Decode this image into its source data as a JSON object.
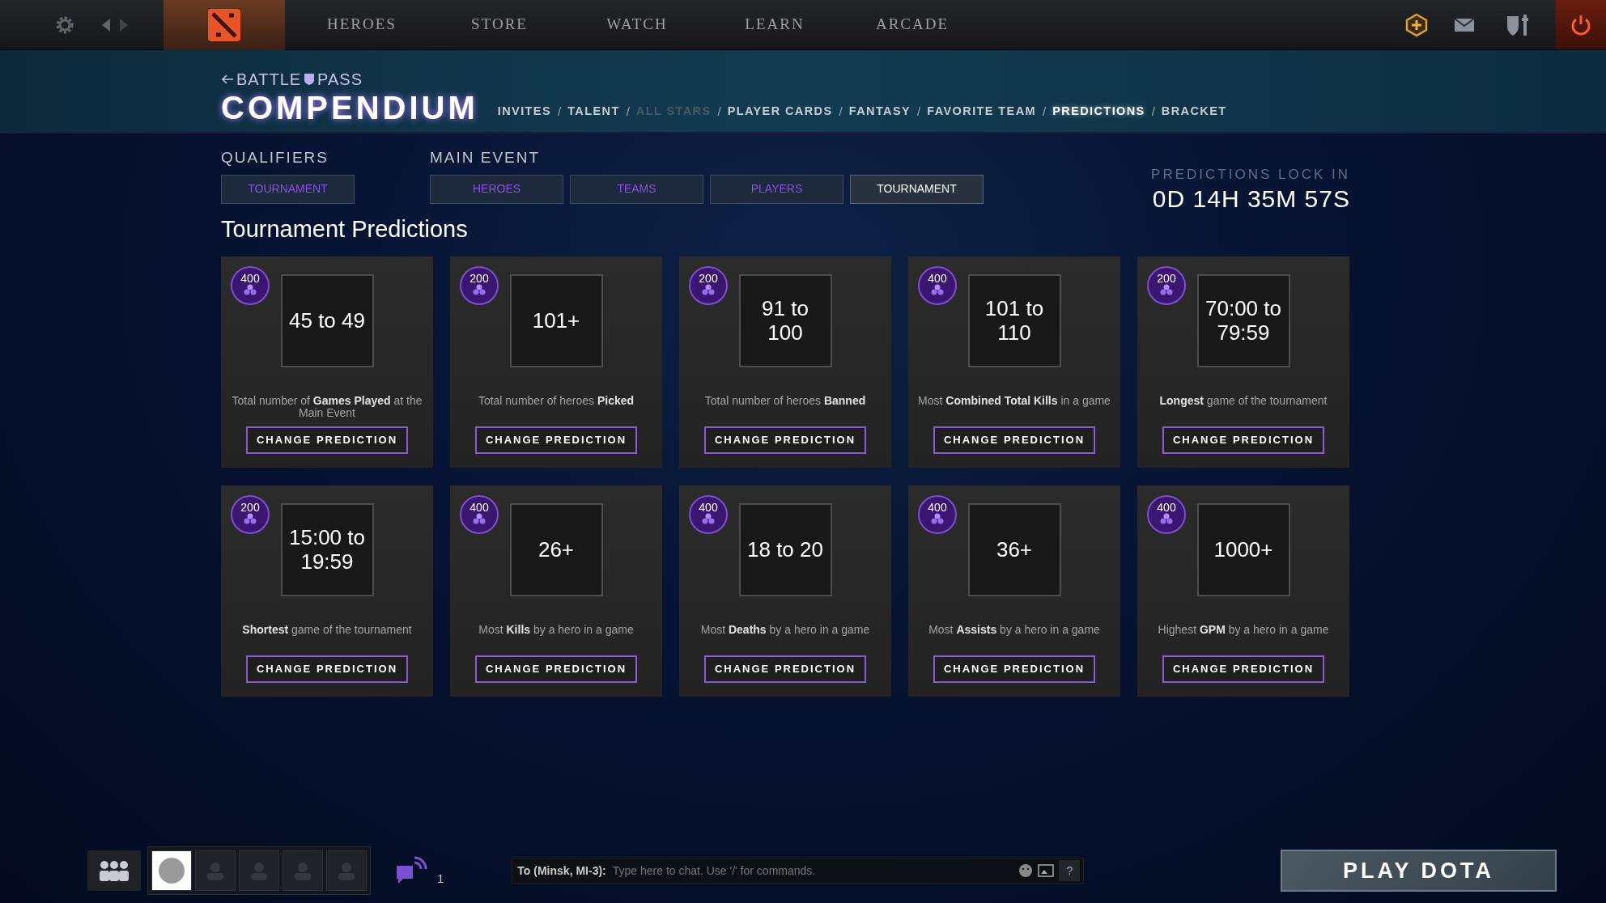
{
  "top_nav": {
    "items": [
      {
        "label": "HEROES"
      },
      {
        "label": "STORE"
      },
      {
        "label": "WATCH"
      },
      {
        "label": "LEARN"
      },
      {
        "label": "ARCADE"
      }
    ]
  },
  "compendium": {
    "back_label": "BATTLE",
    "pass_label": "PASS",
    "title": "COMPENDIUM",
    "separator": "/",
    "nav": [
      {
        "label": "INVITES",
        "selected": false,
        "disabled": false
      },
      {
        "label": "TALENT",
        "selected": false,
        "disabled": false
      },
      {
        "label": "ALL STARS",
        "selected": false,
        "disabled": true
      },
      {
        "label": "PLAYER CARDS",
        "selected": false,
        "disabled": false
      },
      {
        "label": "FANTASY",
        "selected": false,
        "disabled": false
      },
      {
        "label": "FAVORITE TEAM",
        "selected": false,
        "disabled": false
      },
      {
        "label": "PREDICTIONS",
        "selected": true,
        "disabled": false
      },
      {
        "label": "BRACKET",
        "selected": false,
        "disabled": false
      }
    ]
  },
  "tab_groups": [
    {
      "title": "QUALIFIERS",
      "tabs": [
        {
          "label": "TOURNAMENT",
          "selected": false
        }
      ]
    },
    {
      "title": "MAIN EVENT",
      "tabs": [
        {
          "label": "HEROES",
          "selected": false
        },
        {
          "label": "TEAMS",
          "selected": false
        },
        {
          "label": "PLAYERS",
          "selected": false
        },
        {
          "label": "TOURNAMENT",
          "selected": true
        }
      ]
    }
  ],
  "lock": {
    "label": "PREDICTIONS LOCK IN",
    "time": "0D 14H 35M 57S"
  },
  "heading": "Tournament Predictions",
  "cards": [
    {
      "points": "400",
      "value": "45 to 49",
      "description": "Total number of **Games Played** at the Main Event",
      "button": "CHANGE PREDICTION"
    },
    {
      "points": "200",
      "value": "101+",
      "description": "Total number of heroes **Picked**",
      "button": "CHANGE PREDICTION"
    },
    {
      "points": "200",
      "value": "91 to 100",
      "description": "Total number of heroes **Banned**",
      "button": "CHANGE PREDICTION"
    },
    {
      "points": "400",
      "value": "101 to 110",
      "description": "Most **Combined Total Kills** in a game",
      "button": "CHANGE PREDICTION"
    },
    {
      "points": "200",
      "value": "70:00 to 79:59",
      "description": "**Longest** game of the tournament",
      "button": "CHANGE PREDICTION"
    },
    {
      "points": "200",
      "value": "15:00 to 19:59",
      "description": "**Shortest** game of the tournament",
      "button": "CHANGE PREDICTION"
    },
    {
      "points": "400",
      "value": "26+",
      "description": "Most **Kills** by a hero in a game",
      "button": "CHANGE PREDICTION"
    },
    {
      "points": "400",
      "value": "18 to 20",
      "description": "Most **Deaths** by a hero in a game",
      "button": "CHANGE PREDICTION"
    },
    {
      "points": "400",
      "value": "36+",
      "description": "Most **Assists** by a hero in a game",
      "button": "CHANGE PREDICTION"
    },
    {
      "points": "400",
      "value": "1000+",
      "description": "Highest **GPM** by a hero in a game",
      "button": "CHANGE PREDICTION"
    }
  ],
  "bottom_bar": {
    "party_slots": [
      {
        "filled": true
      },
      {
        "filled": false
      },
      {
        "filled": false
      },
      {
        "filled": false
      },
      {
        "filled": false
      }
    ],
    "chat_channels_count": "1",
    "chat": {
      "prefix": "To (Minsk, MI-3):",
      "placeholder": "Type here to chat. Use '/' for commands.",
      "help": "?"
    },
    "play_button": "PLAY DOTA"
  }
}
